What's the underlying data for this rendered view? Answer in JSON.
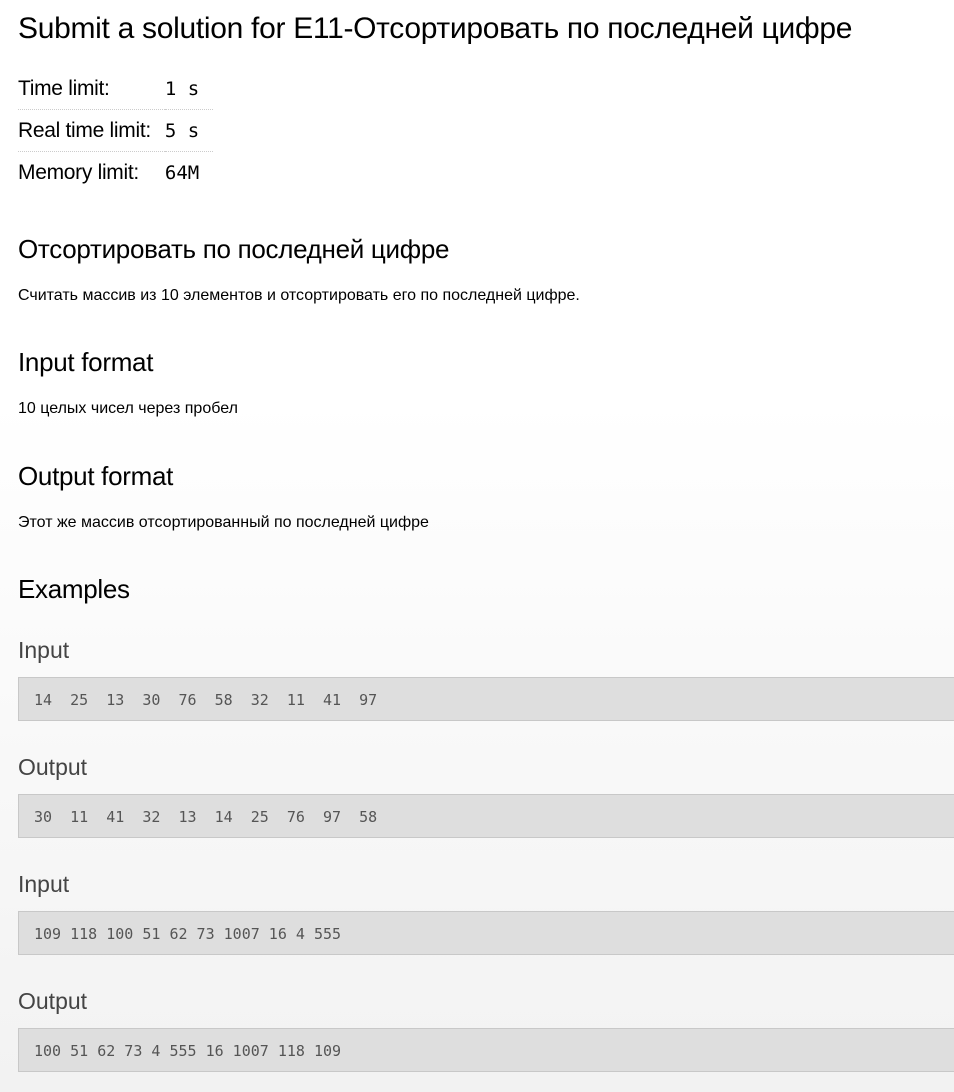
{
  "title": "Submit a solution for E11-Отсортировать по последней цифре",
  "limits": [
    {
      "label": "Time limit:",
      "value": "1 s"
    },
    {
      "label": "Real time limit:",
      "value": "5 s"
    },
    {
      "label": "Memory limit:",
      "value": "64M"
    }
  ],
  "statement": {
    "heading": "Отсортировать по последней цифре",
    "text": "Считать массив из 10 элементов и отсортировать его по последней цифре."
  },
  "input_format": {
    "heading": "Input format",
    "text": "10 целых чисел через пробел"
  },
  "output_format": {
    "heading": "Output format",
    "text": "Этот же массив отсортированный по последней цифре"
  },
  "examples": {
    "heading": "Examples",
    "items": [
      {
        "label": "Input",
        "value": "14  25  13  30  76  58  32  11  41  97"
      },
      {
        "label": "Output",
        "value": "30  11  41  32  13  14  25  76  97  58"
      },
      {
        "label": "Input",
        "value": "109 118 100 51 62 73 1007 16 4 555"
      },
      {
        "label": "Output",
        "value": "100 51 62 73 4 555 16 1007 118 109"
      }
    ]
  }
}
